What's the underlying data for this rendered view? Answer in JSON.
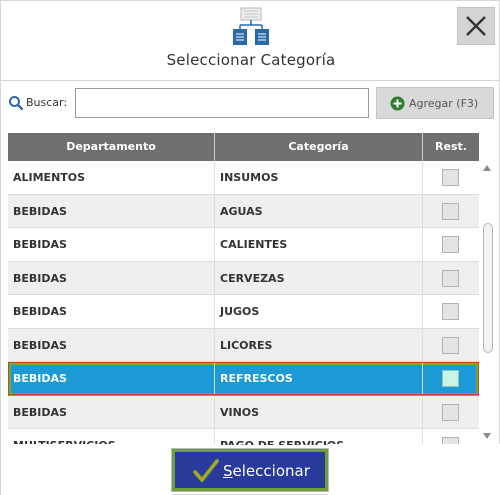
{
  "dialog": {
    "title": "Seleccionar Categoría",
    "close_icon": "close-icon",
    "header_icon": "category-tree-icon"
  },
  "search": {
    "label": "Buscar:",
    "value": "",
    "placeholder": "",
    "icon": "search-icon"
  },
  "add_button": {
    "label": "Agregar (F3)",
    "icon": "plus-circle-icon"
  },
  "table": {
    "headers": [
      "Departamento",
      "Categoría",
      "Rest."
    ],
    "rows": [
      {
        "departamento": "ALIMENTOS",
        "categoria": "INSUMOS",
        "selected": false
      },
      {
        "departamento": "BEBIDAS",
        "categoria": "AGUAS",
        "selected": false
      },
      {
        "departamento": "BEBIDAS",
        "categoria": "CALIENTES",
        "selected": false
      },
      {
        "departamento": "BEBIDAS",
        "categoria": "CERVEZAS",
        "selected": false
      },
      {
        "departamento": "BEBIDAS",
        "categoria": "JUGOS",
        "selected": false
      },
      {
        "departamento": "BEBIDAS",
        "categoria": "LICORES",
        "selected": false
      },
      {
        "departamento": "BEBIDAS",
        "categoria": "REFRESCOS",
        "selected": true
      },
      {
        "departamento": "BEBIDAS",
        "categoria": "VINOS",
        "selected": false
      },
      {
        "departamento": "MULTISERVICIOS",
        "categoria": "PAGO DE SERVICIOS",
        "selected": false
      }
    ]
  },
  "select_button": {
    "label_underlined": "S",
    "label_rest": "eleccionar",
    "icon": "checkmark-icon"
  },
  "colors": {
    "header_bg": "#6f6f6f",
    "selected_row": "#1c9ad6",
    "select_button_bg": "#293a9b",
    "select_button_border": "#6d9f33"
  }
}
